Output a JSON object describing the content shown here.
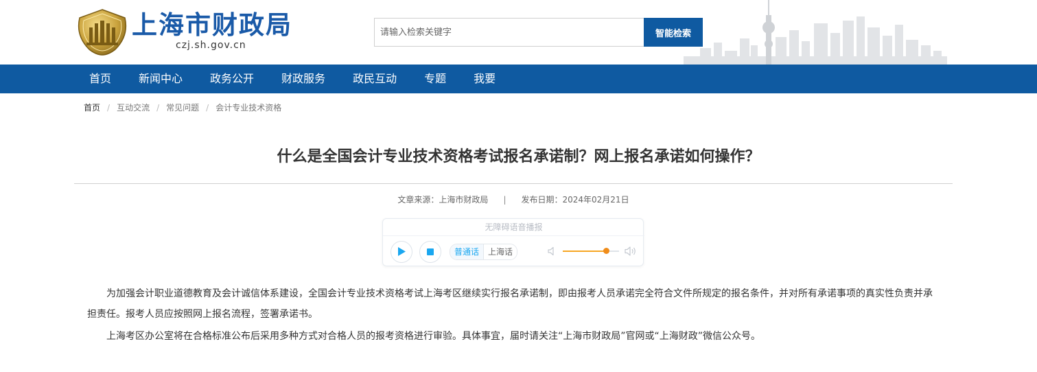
{
  "header": {
    "site_name": "上海市财政局",
    "site_domain": "czj.sh.gov.cn",
    "search": {
      "placeholder": "请输入检索关键字",
      "value": "",
      "button_label": "智能检索"
    }
  },
  "nav": {
    "items": [
      {
        "label": "首页"
      },
      {
        "label": "新闻中心"
      },
      {
        "label": "政务公开"
      },
      {
        "label": "财政服务"
      },
      {
        "label": "政民互动"
      },
      {
        "label": "专题"
      },
      {
        "label": "我要"
      }
    ]
  },
  "breadcrumb": {
    "items": [
      {
        "label": "首页"
      },
      {
        "label": "互动交流"
      },
      {
        "label": "常见问题"
      },
      {
        "label": "会计专业技术资格"
      }
    ],
    "separator": "/"
  },
  "article": {
    "title": "什么是全国会计专业技术资格考试报名承诺制？网上报名承诺如何操作？",
    "source": "文章来源：上海市财政局",
    "meta_separator": "|",
    "date": "发布日期：2024年02月21日",
    "paragraphs": [
      "为加强会计职业道德教育及会计诚信体系建设，全国会计专业技术资格考试上海考区继续实行报名承诺制，即由报考人员承诺完全符合文件所规定的报名条件，并对所有承诺事项的真实性负责并承担责任。报考人员应按照网上报名流程，签署承诺书。",
      "上海考区办公室将在合格标准公布后采用多种方式对合格人员的报考资格进行审验。具体事宜，届时请关注“上海市财政局”官网或“上海财政”微信公众号。"
    ]
  },
  "audio_player": {
    "title": "无障碍语音播报",
    "dialects": [
      "普通话",
      "上海话"
    ],
    "selected_dialect": "普通话",
    "volume": 0.77
  },
  "colors": {
    "brand_blue": "#0f5aa1",
    "title_blue": "#1a5aa8",
    "player_accent": "#1aa7f0",
    "volume_orange": "#f08c1a"
  }
}
